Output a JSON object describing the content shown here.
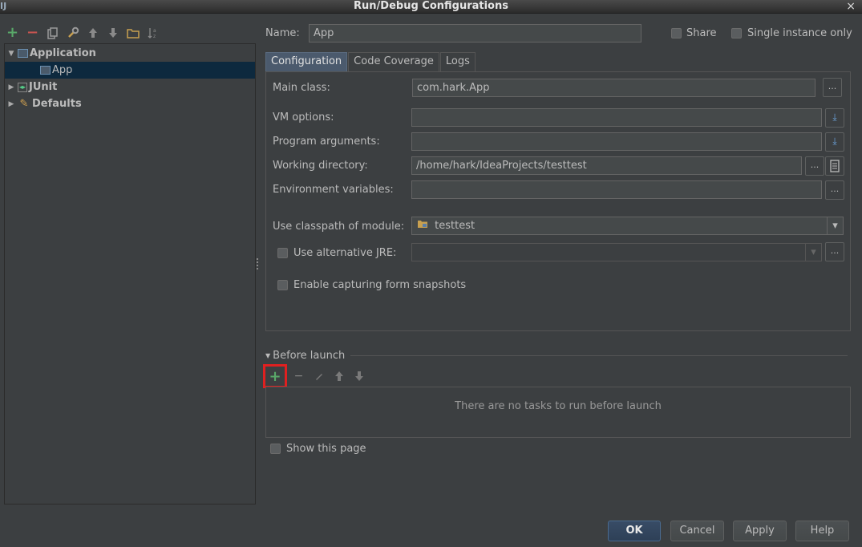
{
  "window": {
    "title": "Run/Debug Configurations",
    "app_icon": "IJ",
    "close_glyph": "×"
  },
  "left_toolbar": {
    "buttons": [
      "add-icon",
      "remove-icon",
      "copy-icon",
      "wrench-icon",
      "arrow-up-icon",
      "arrow-down-icon",
      "folder-icon",
      "sort-icon"
    ]
  },
  "tree": {
    "items": [
      {
        "label": "Application",
        "expanded": true
      },
      {
        "label": "App",
        "selected": true
      },
      {
        "label": "JUnit",
        "expanded": false
      },
      {
        "label": "Defaults",
        "expanded": false
      }
    ]
  },
  "header": {
    "name_label": "Name:",
    "name_value": "App",
    "share_label": "Share",
    "single_instance_label": "Single instance only"
  },
  "tabs": [
    "Configuration",
    "Code Coverage",
    "Logs"
  ],
  "config": {
    "main_class_label": "Main class:",
    "main_class_value": "com.hark.App",
    "vm_options_label": "VM options:",
    "vm_options_value": "",
    "program_args_label": "Program arguments:",
    "program_args_value": "",
    "working_dir_label": "Working directory:",
    "working_dir_value": "/home/hark/IdeaProjects/testtest",
    "env_vars_label": "Environment variables:",
    "env_vars_value": "",
    "classpath_label": "Use classpath of module:",
    "classpath_value": "testtest",
    "alt_jre_label": "Use alternative JRE:",
    "alt_jre_value": "",
    "snapshots_label": "Enable capturing form snapshots",
    "ellipsis": "...",
    "expand_glyph": "⤓",
    "dropdown_glyph": "▾"
  },
  "before_launch": {
    "title": "Before launch",
    "empty_text": "There are no tasks to run before launch",
    "show_page_label": "Show this page"
  },
  "buttons": {
    "ok": "OK",
    "cancel": "Cancel",
    "apply": "Apply",
    "help": "Help"
  },
  "colors": {
    "accent_selection": "#0d293e",
    "add_green": "#59a869",
    "remove_red": "#c75450",
    "highlight_box": "#e02020"
  }
}
